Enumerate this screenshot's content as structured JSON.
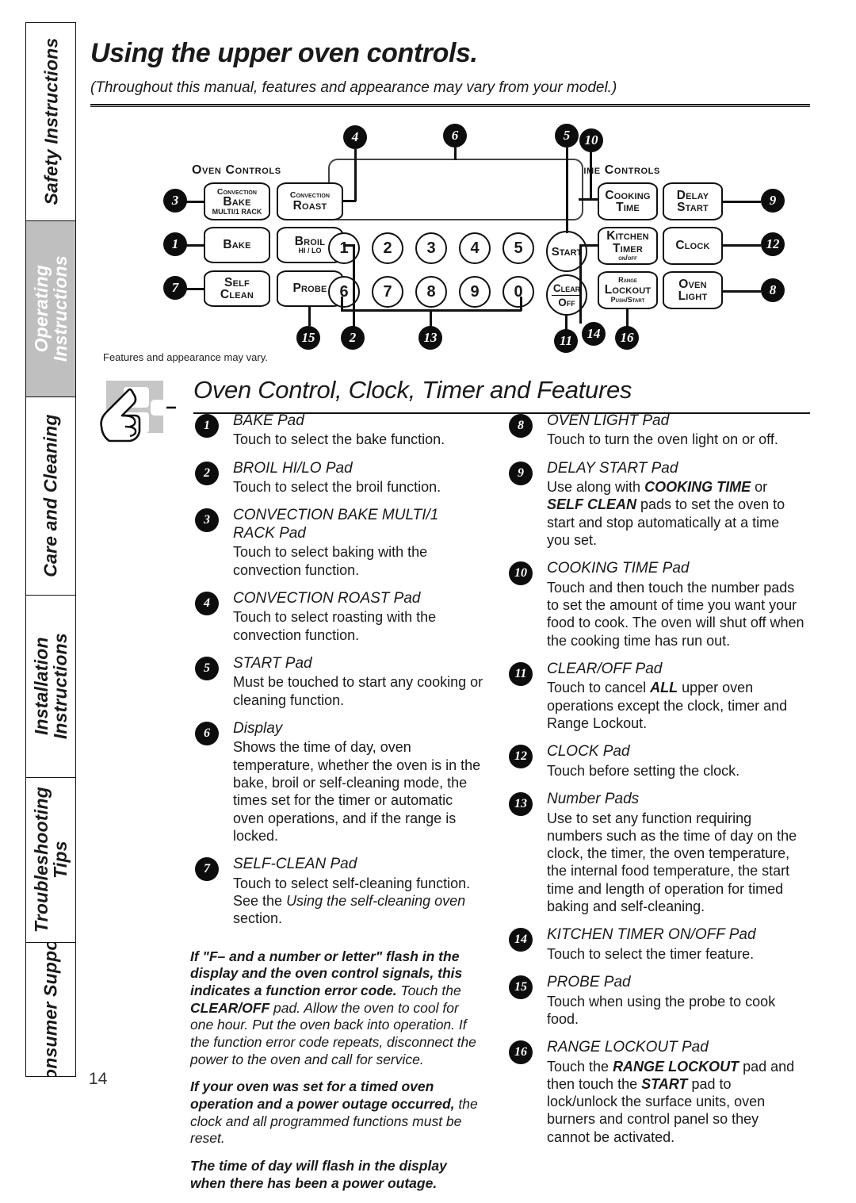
{
  "page_number": "14",
  "header": {
    "title": "Using the upper oven controls.",
    "subtitle": "(Throughout this manual, features and appearance may vary from your model.)"
  },
  "sidebar": {
    "tabs": [
      {
        "label": "Safety Instructions",
        "active": false
      },
      {
        "label": "Operating\nInstructions",
        "active": true
      },
      {
        "label": "Care and Cleaning",
        "active": false
      },
      {
        "label": "Installation\nInstructions",
        "active": false
      },
      {
        "label": "Troubleshooting\nTips",
        "active": false
      },
      {
        "label": "Consumer Support",
        "active": false
      }
    ]
  },
  "diagram": {
    "caption": "Features and appearance may vary.",
    "oven_controls_title": "Oven Controls",
    "time_controls_title": "Time Controls",
    "pads": {
      "convection_bake_l1": "Convection",
      "convection_bake_l2": "Bake",
      "convection_bake_l3": "MULTI/1 RACK",
      "convection_roast_l1": "Convection",
      "convection_roast_l2": "Roast",
      "bake": "Bake",
      "broil_l1": "Broil",
      "broil_l2": "HI / LO",
      "self_clean_l1": "Self",
      "self_clean_l2": "Clean",
      "probe": "Probe",
      "start": "Start",
      "clear": "Clear",
      "off": "Off",
      "cooking_time_l1": "Cooking",
      "cooking_time_l2": "Time",
      "delay_start_l1": "Delay",
      "delay_start_l2": "Start",
      "kitchen_timer_l1": "Kitchen",
      "kitchen_timer_l2": "Timer",
      "kitchen_timer_l3": "on/off",
      "clock": "Clock",
      "range_lockout_l1": "Range",
      "range_lockout_l2": "Lockout",
      "range_lockout_l3": "Push/Start",
      "oven_light_l1": "Oven",
      "oven_light_l2": "Light"
    },
    "number_keys_row1": [
      "1",
      "2",
      "3",
      "4",
      "5"
    ],
    "number_keys_row2": [
      "6",
      "7",
      "8",
      "9",
      "0"
    ],
    "callouts": [
      "1",
      "2",
      "3",
      "4",
      "5",
      "6",
      "7",
      "8",
      "9",
      "10",
      "11",
      "12",
      "13",
      "14",
      "15",
      "16"
    ]
  },
  "section": {
    "title": "Oven Control, Clock, Timer and Features"
  },
  "left_entries": [
    {
      "num": "1",
      "title": "BAKE Pad",
      "body": "Touch to select the bake function."
    },
    {
      "num": "2",
      "title": "BROIL HI/LO Pad",
      "body": "Touch to select the broil function."
    },
    {
      "num": "3",
      "title": "CONVECTION BAKE MULTI/1 RACK Pad",
      "body": "Touch to select baking with the convection function."
    },
    {
      "num": "4",
      "title": "CONVECTION ROAST Pad",
      "body": "Touch to select roasting with the convection function."
    },
    {
      "num": "5",
      "title": "START Pad",
      "body": "Must be touched to start any cooking or cleaning function."
    },
    {
      "num": "6",
      "title": "Display",
      "body": "Shows the time of day, oven temperature, whether the oven is in the bake, broil or self-cleaning mode, the times set for the timer or automatic oven operations, and if the range is locked."
    },
    {
      "num": "7",
      "title": "SELF-CLEAN Pad",
      "body": "Touch to select self-cleaning function. See the Using the self-cleaning oven section."
    }
  ],
  "right_entries": [
    {
      "num": "8",
      "title": "OVEN LIGHT Pad",
      "body": "Touch to turn the oven light on or off."
    },
    {
      "num": "9",
      "title": "DELAY START Pad",
      "body": "Use along with COOKING TIME or SELF CLEAN pads to set the oven to start and stop automatically at a time you set."
    },
    {
      "num": "10",
      "title": "COOKING TIME Pad",
      "body": "Touch and then touch the number pads to set the amount of time you want your food to cook. The oven will shut off when the cooking time has run out."
    },
    {
      "num": "11",
      "title": "CLEAR/OFF Pad",
      "body": "Touch to cancel ALL  upper oven operations except the clock, timer and Range Lockout."
    },
    {
      "num": "12",
      "title": "CLOCK Pad",
      "body": "Touch before setting the clock."
    },
    {
      "num": "13",
      "title": "Number Pads",
      "body": "Use to set any function requiring numbers such as the time of day on the clock, the timer, the oven temperature, the internal food temperature, the start time and length of operation for timed baking and self-cleaning."
    },
    {
      "num": "14",
      "title": "KITCHEN TIMER ON/OFF Pad",
      "body": "Touch to select the timer feature."
    },
    {
      "num": "15",
      "title": "PROBE Pad",
      "body": "Touch when using the probe to cook food."
    },
    {
      "num": "16",
      "title": "RANGE LOCKOUT Pad",
      "body": "Touch the RANGE LOCKOUT pad and then touch the START pad to lock/unlock the surface units, oven burners and control panel so they cannot be activated."
    }
  ],
  "notes": [
    "If \"F– and a number or letter\" flash in the display and the oven control signals, this indicates a function error code. Touch the CLEAR/OFF pad. Allow the oven to cool for one hour. Put the oven back into operation. If the function error code repeats, disconnect the power to the oven and call for service.",
    "If your oven was set for a timed oven operation and a power outage occurred, the clock and all programmed functions must be reset.",
    "The time of day will flash in the display when there has been a power outage."
  ]
}
